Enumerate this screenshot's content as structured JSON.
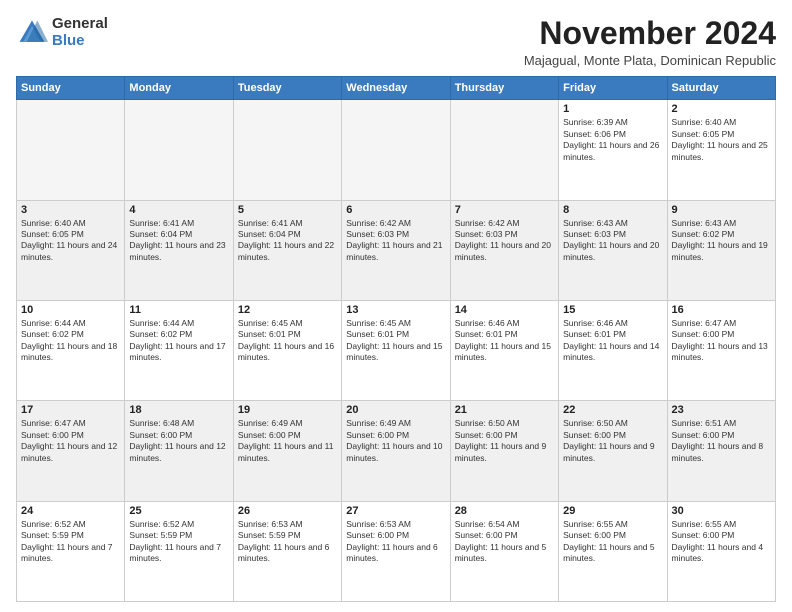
{
  "logo": {
    "general": "General",
    "blue": "Blue"
  },
  "title": "November 2024",
  "location": "Majagual, Monte Plata, Dominican Republic",
  "days_of_week": [
    "Sunday",
    "Monday",
    "Tuesday",
    "Wednesday",
    "Thursday",
    "Friday",
    "Saturday"
  ],
  "weeks": [
    [
      {
        "day": "",
        "empty": true
      },
      {
        "day": "",
        "empty": true
      },
      {
        "day": "",
        "empty": true
      },
      {
        "day": "",
        "empty": true
      },
      {
        "day": "",
        "empty": true
      },
      {
        "day": "1",
        "sunrise": "Sunrise: 6:39 AM",
        "sunset": "Sunset: 6:06 PM",
        "daylight": "Daylight: 11 hours and 26 minutes."
      },
      {
        "day": "2",
        "sunrise": "Sunrise: 6:40 AM",
        "sunset": "Sunset: 6:05 PM",
        "daylight": "Daylight: 11 hours and 25 minutes."
      }
    ],
    [
      {
        "day": "3",
        "sunrise": "Sunrise: 6:40 AM",
        "sunset": "Sunset: 6:05 PM",
        "daylight": "Daylight: 11 hours and 24 minutes."
      },
      {
        "day": "4",
        "sunrise": "Sunrise: 6:41 AM",
        "sunset": "Sunset: 6:04 PM",
        "daylight": "Daylight: 11 hours and 23 minutes."
      },
      {
        "day": "5",
        "sunrise": "Sunrise: 6:41 AM",
        "sunset": "Sunset: 6:04 PM",
        "daylight": "Daylight: 11 hours and 22 minutes."
      },
      {
        "day": "6",
        "sunrise": "Sunrise: 6:42 AM",
        "sunset": "Sunset: 6:03 PM",
        "daylight": "Daylight: 11 hours and 21 minutes."
      },
      {
        "day": "7",
        "sunrise": "Sunrise: 6:42 AM",
        "sunset": "Sunset: 6:03 PM",
        "daylight": "Daylight: 11 hours and 20 minutes."
      },
      {
        "day": "8",
        "sunrise": "Sunrise: 6:43 AM",
        "sunset": "Sunset: 6:03 PM",
        "daylight": "Daylight: 11 hours and 20 minutes."
      },
      {
        "day": "9",
        "sunrise": "Sunrise: 6:43 AM",
        "sunset": "Sunset: 6:02 PM",
        "daylight": "Daylight: 11 hours and 19 minutes."
      }
    ],
    [
      {
        "day": "10",
        "sunrise": "Sunrise: 6:44 AM",
        "sunset": "Sunset: 6:02 PM",
        "daylight": "Daylight: 11 hours and 18 minutes."
      },
      {
        "day": "11",
        "sunrise": "Sunrise: 6:44 AM",
        "sunset": "Sunset: 6:02 PM",
        "daylight": "Daylight: 11 hours and 17 minutes."
      },
      {
        "day": "12",
        "sunrise": "Sunrise: 6:45 AM",
        "sunset": "Sunset: 6:01 PM",
        "daylight": "Daylight: 11 hours and 16 minutes."
      },
      {
        "day": "13",
        "sunrise": "Sunrise: 6:45 AM",
        "sunset": "Sunset: 6:01 PM",
        "daylight": "Daylight: 11 hours and 15 minutes."
      },
      {
        "day": "14",
        "sunrise": "Sunrise: 6:46 AM",
        "sunset": "Sunset: 6:01 PM",
        "daylight": "Daylight: 11 hours and 15 minutes."
      },
      {
        "day": "15",
        "sunrise": "Sunrise: 6:46 AM",
        "sunset": "Sunset: 6:01 PM",
        "daylight": "Daylight: 11 hours and 14 minutes."
      },
      {
        "day": "16",
        "sunrise": "Sunrise: 6:47 AM",
        "sunset": "Sunset: 6:00 PM",
        "daylight": "Daylight: 11 hours and 13 minutes."
      }
    ],
    [
      {
        "day": "17",
        "sunrise": "Sunrise: 6:47 AM",
        "sunset": "Sunset: 6:00 PM",
        "daylight": "Daylight: 11 hours and 12 minutes."
      },
      {
        "day": "18",
        "sunrise": "Sunrise: 6:48 AM",
        "sunset": "Sunset: 6:00 PM",
        "daylight": "Daylight: 11 hours and 12 minutes."
      },
      {
        "day": "19",
        "sunrise": "Sunrise: 6:49 AM",
        "sunset": "Sunset: 6:00 PM",
        "daylight": "Daylight: 11 hours and 11 minutes."
      },
      {
        "day": "20",
        "sunrise": "Sunrise: 6:49 AM",
        "sunset": "Sunset: 6:00 PM",
        "daylight": "Daylight: 11 hours and 10 minutes."
      },
      {
        "day": "21",
        "sunrise": "Sunrise: 6:50 AM",
        "sunset": "Sunset: 6:00 PM",
        "daylight": "Daylight: 11 hours and 9 minutes."
      },
      {
        "day": "22",
        "sunrise": "Sunrise: 6:50 AM",
        "sunset": "Sunset: 6:00 PM",
        "daylight": "Daylight: 11 hours and 9 minutes."
      },
      {
        "day": "23",
        "sunrise": "Sunrise: 6:51 AM",
        "sunset": "Sunset: 6:00 PM",
        "daylight": "Daylight: 11 hours and 8 minutes."
      }
    ],
    [
      {
        "day": "24",
        "sunrise": "Sunrise: 6:52 AM",
        "sunset": "Sunset: 5:59 PM",
        "daylight": "Daylight: 11 hours and 7 minutes."
      },
      {
        "day": "25",
        "sunrise": "Sunrise: 6:52 AM",
        "sunset": "Sunset: 5:59 PM",
        "daylight": "Daylight: 11 hours and 7 minutes."
      },
      {
        "day": "26",
        "sunrise": "Sunrise: 6:53 AM",
        "sunset": "Sunset: 5:59 PM",
        "daylight": "Daylight: 11 hours and 6 minutes."
      },
      {
        "day": "27",
        "sunrise": "Sunrise: 6:53 AM",
        "sunset": "Sunset: 6:00 PM",
        "daylight": "Daylight: 11 hours and 6 minutes."
      },
      {
        "day": "28",
        "sunrise": "Sunrise: 6:54 AM",
        "sunset": "Sunset: 6:00 PM",
        "daylight": "Daylight: 11 hours and 5 minutes."
      },
      {
        "day": "29",
        "sunrise": "Sunrise: 6:55 AM",
        "sunset": "Sunset: 6:00 PM",
        "daylight": "Daylight: 11 hours and 5 minutes."
      },
      {
        "day": "30",
        "sunrise": "Sunrise: 6:55 AM",
        "sunset": "Sunset: 6:00 PM",
        "daylight": "Daylight: 11 hours and 4 minutes."
      }
    ]
  ]
}
